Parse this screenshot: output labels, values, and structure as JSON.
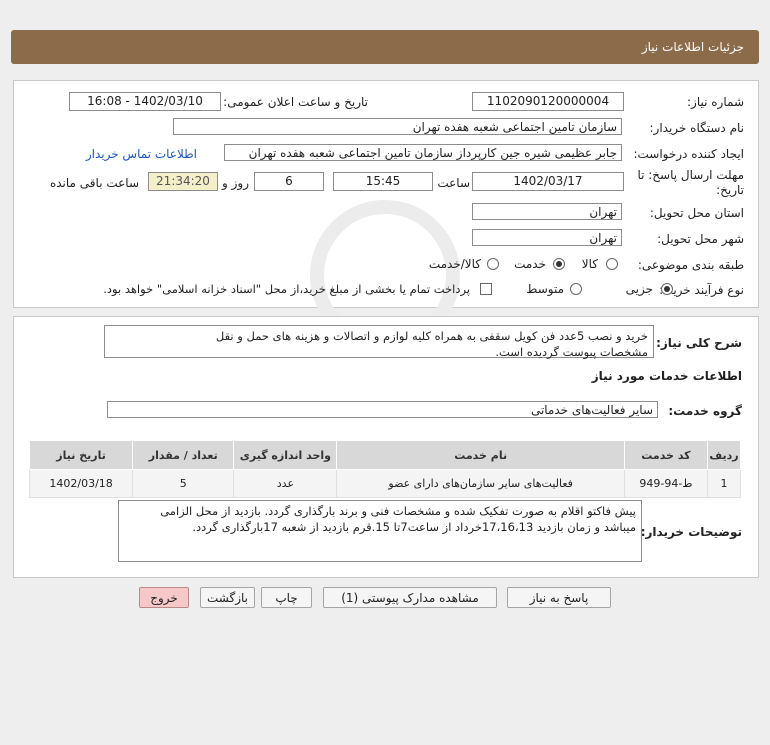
{
  "header": {
    "title": "جزئیات اطلاعات نیاز"
  },
  "form": {
    "need_number_label": "شماره نیاز:",
    "need_number": "1102090120000004",
    "announce_label": "تاریخ و ساعت اعلان عمومی:",
    "announce_value": "1402/03/10 - 16:08",
    "buyer_org_label": "نام دستگاه خریدار:",
    "buyer_org": "سازمان تامین اجتماعی شعبه هفده تهران",
    "requester_label": "ایجاد کننده درخواست:",
    "requester": "جابر عظیمی شیره جین کارپرداز  سازمان تامین اجتماعی شعبه هفده تهران",
    "contact_link": "اطلاعات تماس خریدار",
    "deadline_label_1": "مهلت ارسال پاسخ: تا",
    "deadline_label_2": "تاریخ:",
    "deadline_date": "1402/03/17",
    "time_label": "ساعت",
    "deadline_time": "15:45",
    "days": "6",
    "days_label": "روز و",
    "remaining_time": "21:34:20",
    "remaining_label": "ساعت باقی مانده",
    "province_label": "استان محل تحویل:",
    "province": "تهران",
    "city_label": "شهر محل تحویل:",
    "city": "تهران",
    "category_label": "طبقه بندی موضوعی:",
    "category_options": [
      "کالا",
      "خدمت",
      "کالا/خدمت"
    ],
    "process_label": "نوع فرآیند خرید :",
    "process_options": [
      "جزیی",
      "متوسط"
    ],
    "payment_note": "پرداخت تمام یا بخشی از مبلغ خرید،از محل \"اسناد خزانه اسلامی\" خواهد بود."
  },
  "general": {
    "desc_label": "شرح کلی نیاز:",
    "desc_line1": "خرید و نصب 5عدد فن کویل سقفی به همراه کلیه لوازم و اتصالات و هزینه های حمل و نقل",
    "desc_line2": "مشخصات پیوست گردیده است.",
    "services_title": "اطلاعات خدمات مورد نیاز",
    "service_group_label": "گروه خدمت:",
    "service_group": "سایر فعالیت‌های خدماتی"
  },
  "table": {
    "headers": [
      "ردیف",
      "کد خدمت",
      "نام خدمت",
      "واحد اندازه گیری",
      "تعداد / مقدار",
      "تاریخ نیاز"
    ],
    "rows": [
      [
        "1",
        "ط-94-949",
        "فعالیت‌های سایر سازمان‌های دارای عضو",
        "عدد",
        "5",
        "1402/03/18"
      ]
    ]
  },
  "notes": {
    "label": "توضیحات خریدار:",
    "line1": "پیش فاکتو اقلام به صورت تفکیک شده و مشخصات فنی و برند بارگذاری گردد. بازدید از محل الزامی",
    "line2": "میباشد و زمان بازدید 17،16،13خرداد از ساعت7تا 15.قرم بازدید از شعبه 17بارگذاری گردد."
  },
  "buttons": {
    "reply": "پاسخ به نیاز",
    "docs": "مشاهده مدارک پیوستی (1)",
    "print": "چاپ",
    "back": "بازگشت",
    "exit": "خروج"
  },
  "watermark": {
    "line1": "ParsNamadData",
    "line2": "مرکز فراهم آوری اطلاعات پارس نماد داده",
    "line3": "پایگاه اطلاع رسانی مناقصه ومزایده"
  },
  "colors": {
    "header": "#8b6b4a",
    "exit_button": "#f6c8c8",
    "link": "#1a56c5"
  }
}
